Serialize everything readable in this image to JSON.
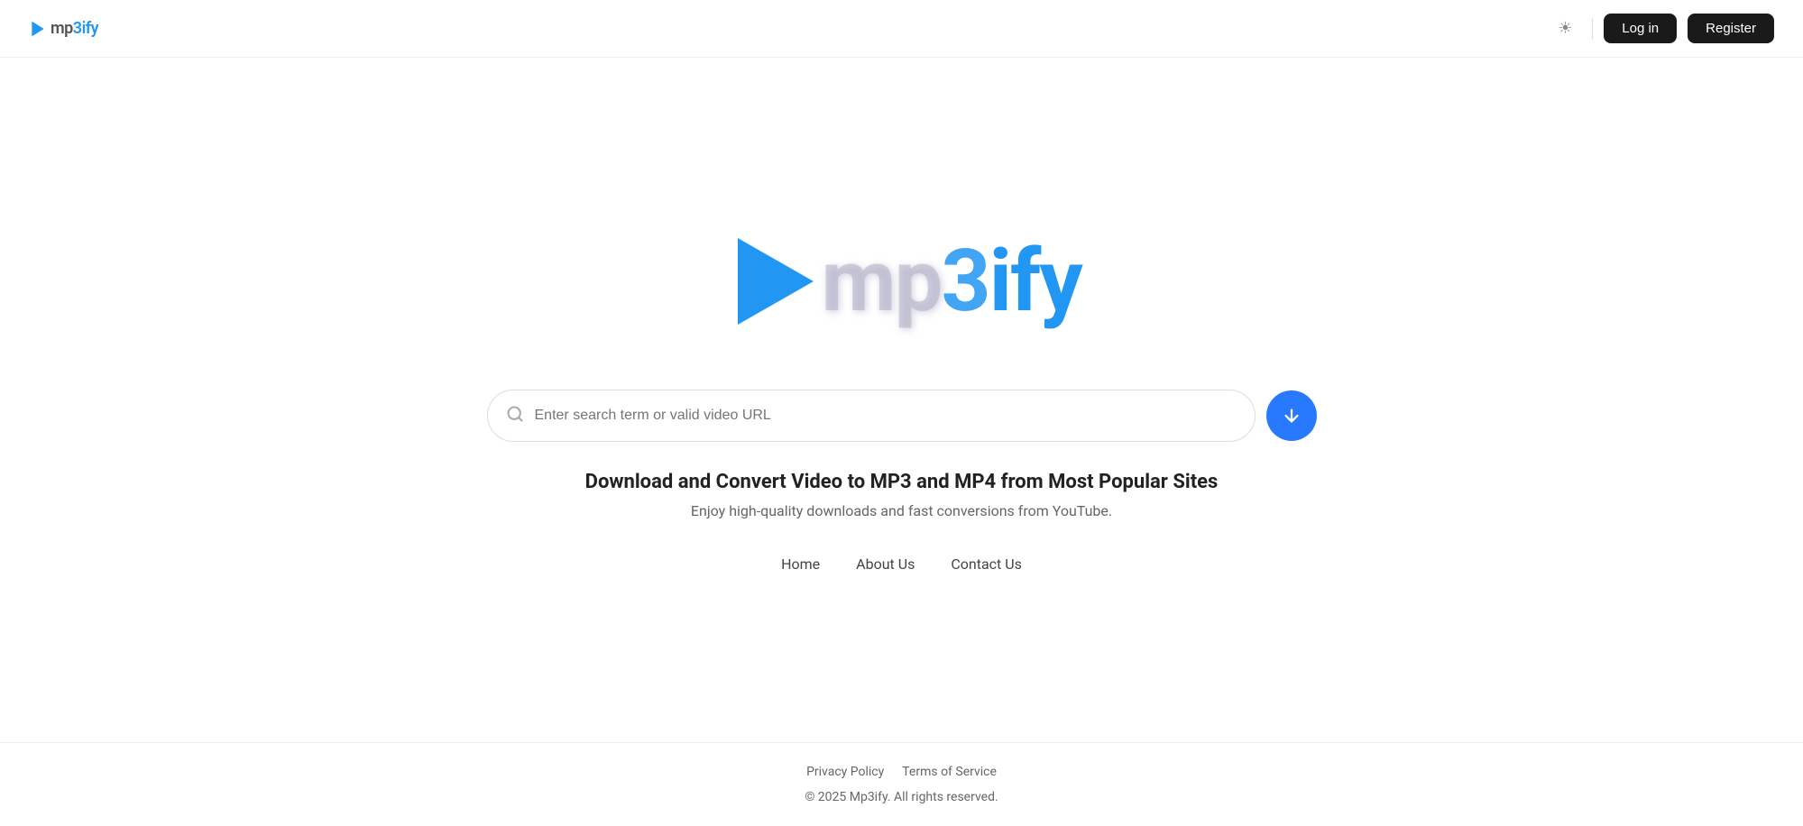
{
  "header": {
    "logo_text": "mp3ify",
    "login_label": "Log in",
    "register_label": "Register",
    "theme_icon": "☀"
  },
  "logo": {
    "mp": "mp",
    "three": "3",
    "ify": "ify"
  },
  "search": {
    "placeholder": "Enter search term or valid video URL"
  },
  "tagline": {
    "title": "Download and Convert Video to MP3 and MP4 from Most Popular Sites",
    "subtitle": "Enjoy high-quality downloads and fast conversions from YouTube."
  },
  "footer_nav": {
    "items": [
      {
        "label": "Home",
        "href": "#"
      },
      {
        "label": "About Us",
        "href": "#"
      },
      {
        "label": "Contact Us",
        "href": "#"
      }
    ]
  },
  "footer": {
    "privacy_policy": "Privacy Policy",
    "terms_of_service": "Terms of Service",
    "copyright": "© 2025 Mp3ify. All rights reserved."
  }
}
